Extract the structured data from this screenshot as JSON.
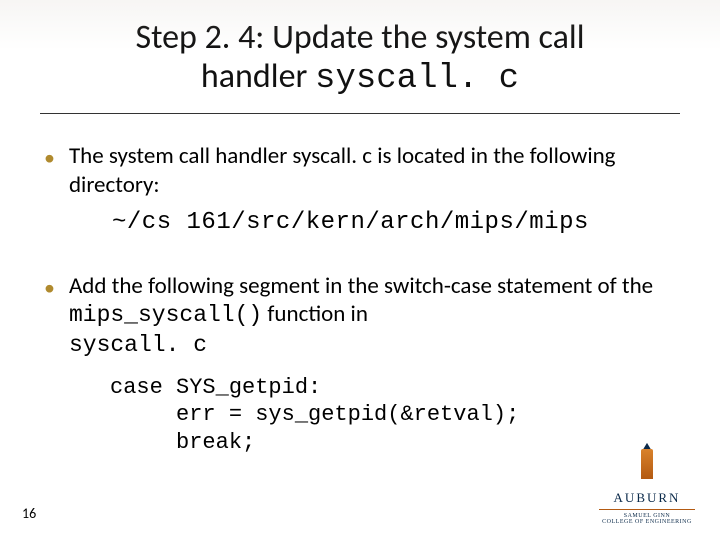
{
  "title": {
    "line1": "Step 2. 4: Update the system call",
    "line2_prefix": "handler ",
    "line2_code": "syscall. c"
  },
  "bullets": [
    {
      "text": "The system call handler syscall. c is located in the following directory:",
      "path": "~/cs 161/src/kern/arch/mips/mips"
    },
    {
      "seg1": "Add the following segment in the switch-case statement of the ",
      "code1": "mips_syscall()",
      "seg2": " function in ",
      "code2": "syscall. c"
    }
  ],
  "code": {
    "l1": "case SYS_getpid:",
    "l2": "     err = sys_getpid(&retval);",
    "l3": "     break;"
  },
  "page_number": "16",
  "logo": {
    "name": "AUBURN",
    "sub1": "Samuel Ginn",
    "sub2": "College of Engineering"
  }
}
